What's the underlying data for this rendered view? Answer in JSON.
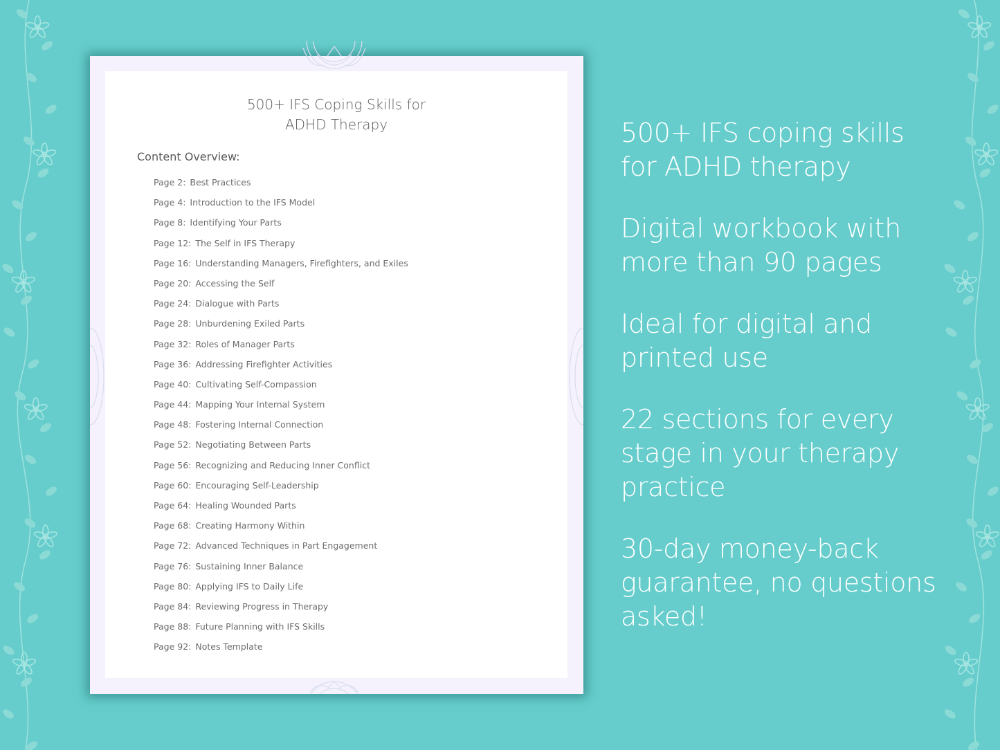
{
  "document": {
    "title_line1": "500+ IFS Coping Skills for",
    "title_line2": "ADHD Therapy",
    "overview_heading": "Content Overview:",
    "toc": [
      {
        "page": "Page  2:",
        "title": "Best Practices"
      },
      {
        "page": "Page  4:",
        "title": "Introduction to the IFS Model"
      },
      {
        "page": "Page  8:",
        "title": "Identifying Your Parts"
      },
      {
        "page": "Page 12:",
        "title": "The Self in IFS Therapy"
      },
      {
        "page": "Page 16:",
        "title": "Understanding Managers, Firefighters, and Exiles"
      },
      {
        "page": "Page 20:",
        "title": "Accessing the Self"
      },
      {
        "page": "Page 24:",
        "title": "Dialogue with Parts"
      },
      {
        "page": "Page 28:",
        "title": "Unburdening Exiled Parts"
      },
      {
        "page": "Page 32:",
        "title": "Roles of Manager Parts"
      },
      {
        "page": "Page 36:",
        "title": "Addressing Firefighter Activities"
      },
      {
        "page": "Page 40:",
        "title": "Cultivating Self-Compassion"
      },
      {
        "page": "Page 44:",
        "title": "Mapping Your Internal System"
      },
      {
        "page": "Page 48:",
        "title": "Fostering Internal Connection"
      },
      {
        "page": "Page 52:",
        "title": "Negotiating Between Parts"
      },
      {
        "page": "Page 56:",
        "title": "Recognizing and Reducing Inner Conflict"
      },
      {
        "page": "Page 60:",
        "title": "Encouraging Self-Leadership"
      },
      {
        "page": "Page 64:",
        "title": "Healing Wounded Parts"
      },
      {
        "page": "Page 68:",
        "title": "Creating Harmony Within"
      },
      {
        "page": "Page 72:",
        "title": "Advanced Techniques in Part Engagement"
      },
      {
        "page": "Page 76:",
        "title": "Sustaining Inner Balance"
      },
      {
        "page": "Page 80:",
        "title": "Applying IFS to Daily Life"
      },
      {
        "page": "Page 84:",
        "title": "Reviewing Progress in Therapy"
      },
      {
        "page": "Page 88:",
        "title": "Future Planning with IFS Skills"
      },
      {
        "page": "Page 92:",
        "title": "Notes Template"
      }
    ]
  },
  "features": [
    "500+ IFS coping skills for ADHD therapy",
    "Digital workbook with more than 90 pages",
    "Ideal for digital and printed use",
    "22 sections for every stage in your therapy practice",
    "30-day money-back guarantee, no questions asked!"
  ],
  "colors": {
    "background": "#66cdcc",
    "page_border": "#f5f2fd",
    "text_dark": "#5a5a5a",
    "feature_text": "#ffffff"
  }
}
